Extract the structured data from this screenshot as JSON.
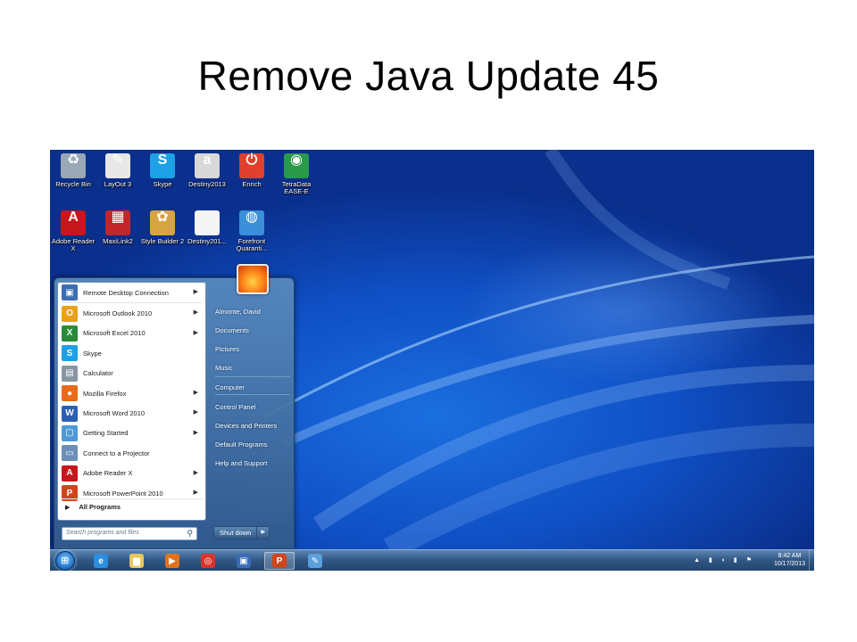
{
  "slide_title": "Remove Java Update 45",
  "desktop_icons": [
    {
      "label": "Recycle Bin",
      "icon": "recycle-bin-icon",
      "color": "#9aa7b4",
      "glyph": "♻"
    },
    {
      "label": "LayOut 3",
      "icon": "layout-icon",
      "color": "#e8e8e8",
      "glyph": "✎"
    },
    {
      "label": "Skype",
      "icon": "skype-icon",
      "color": "#1da1e6",
      "glyph": "S"
    },
    {
      "label": "Destiny2013",
      "icon": "destiny-icon",
      "color": "#d8d8d8",
      "glyph": "a"
    },
    {
      "label": "Enrich",
      "icon": "enrich-icon",
      "color": "#e0402e",
      "glyph": "⏻"
    },
    {
      "label": "TetraData EASE-E",
      "icon": "tetradata-icon",
      "color": "#2a9a4a",
      "glyph": "◉"
    },
    {
      "label": "Adobe Reader X",
      "icon": "adobe-reader-icon",
      "color": "#c8161d",
      "glyph": "A"
    },
    {
      "label": "MaxiLink2",
      "icon": "maxilink-icon",
      "color": "#c0262b",
      "glyph": "▦"
    },
    {
      "label": "Style Builder 2",
      "icon": "style-builder-icon",
      "color": "#d9a443",
      "glyph": "✿"
    },
    {
      "label": "Destiny201...",
      "icon": "document-icon",
      "color": "#f4f4f4",
      "glyph": ""
    },
    {
      "label": "Forefront Quaranti...",
      "icon": "forefront-icon",
      "color": "#3a8fd8",
      "glyph": "◍"
    }
  ],
  "start_menu": {
    "programs": [
      {
        "label": "Remote Desktop Connection",
        "icon": "remote-desktop-icon",
        "color": "#3b6cb5",
        "glyph": "▣",
        "has_arrow": true
      },
      {
        "label": "Microsoft Outlook 2010",
        "icon": "outlook-icon",
        "color": "#e9a01b",
        "glyph": "O",
        "has_arrow": true
      },
      {
        "label": "Microsoft Excel 2010",
        "icon": "excel-icon",
        "color": "#2a8a3c",
        "glyph": "X",
        "has_arrow": true
      },
      {
        "label": "Skype",
        "icon": "skype-icon",
        "color": "#1da1e6",
        "glyph": "S",
        "has_arrow": false
      },
      {
        "label": "Calculator",
        "icon": "calculator-icon",
        "color": "#8895a4",
        "glyph": "▤",
        "has_arrow": false
      },
      {
        "label": "Mozilla Firefox",
        "icon": "firefox-icon",
        "color": "#e86a1a",
        "glyph": "●",
        "has_arrow": true
      },
      {
        "label": "Microsoft Word 2010",
        "icon": "word-icon",
        "color": "#2b5fb4",
        "glyph": "W",
        "has_arrow": true
      },
      {
        "label": "Getting Started",
        "icon": "getting-started-icon",
        "color": "#4c9ad8",
        "glyph": "▢",
        "has_arrow": true
      },
      {
        "label": "Connect to a Projector",
        "icon": "projector-icon",
        "color": "#6b8fb8",
        "glyph": "▭",
        "has_arrow": false
      },
      {
        "label": "Adobe Reader X",
        "icon": "adobe-reader-icon",
        "color": "#c8161d",
        "glyph": "A",
        "has_arrow": true
      },
      {
        "label": "Microsoft PowerPoint 2010",
        "icon": "powerpoint-icon",
        "color": "#d0461c",
        "glyph": "P",
        "has_arrow": true
      }
    ],
    "all_programs": "All Programs",
    "search_placeholder": "Search programs and files",
    "places": [
      "Almonte, David",
      "Documents",
      "Pictures",
      "Music",
      "Computer",
      "Control Panel",
      "Devices and Printers",
      "Default Programs",
      "Help and Support"
    ],
    "shutdown": "Shut down"
  },
  "taskbar": {
    "start": "start-orb-icon",
    "pinned": [
      {
        "icon": "internet-explorer-icon",
        "color": "#2a8fe0",
        "glyph": "e"
      },
      {
        "icon": "file-explorer-icon",
        "color": "#e9c85a",
        "glyph": "▆"
      },
      {
        "icon": "media-player-icon",
        "color": "#e3721c",
        "glyph": "▶"
      },
      {
        "icon": "chrome-icon",
        "color": "#d9352b",
        "glyph": "◎"
      },
      {
        "icon": "remote-desktop-icon",
        "color": "#3b6cb5",
        "glyph": "▣"
      },
      {
        "icon": "powerpoint-icon",
        "color": "#d0461c",
        "glyph": "P"
      },
      {
        "icon": "paint-icon",
        "color": "#5aa0dc",
        "glyph": "✎"
      }
    ],
    "time": "8:42 AM",
    "date": "10/17/2013"
  }
}
